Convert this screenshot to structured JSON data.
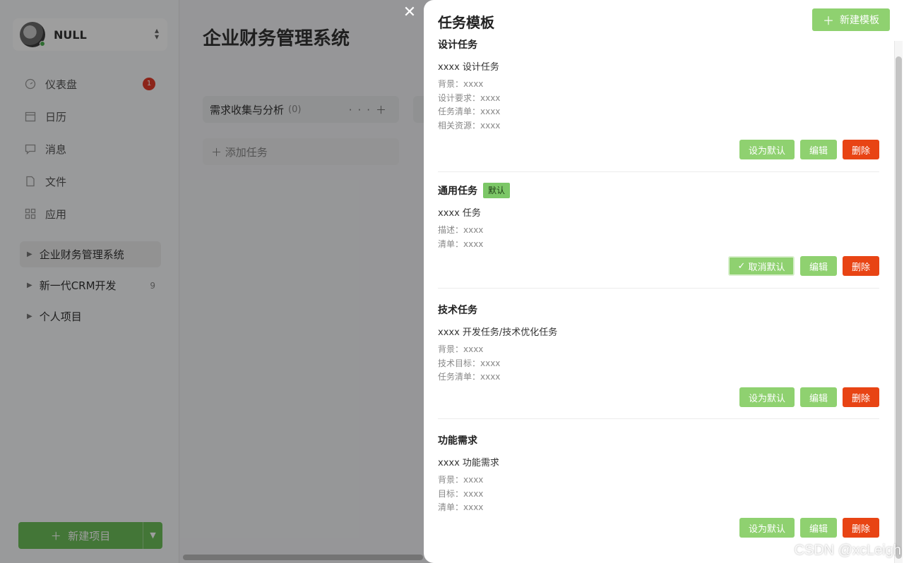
{
  "user": {
    "name": "NULL"
  },
  "nav": [
    {
      "label": "仪表盘",
      "icon": "dashboard-icon",
      "badge": "1"
    },
    {
      "label": "日历",
      "icon": "calendar-icon"
    },
    {
      "label": "消息",
      "icon": "message-icon"
    },
    {
      "label": "文件",
      "icon": "file-icon"
    },
    {
      "label": "应用",
      "icon": "apps-icon"
    }
  ],
  "projects": [
    {
      "label": "企业财务管理系统",
      "count": ""
    },
    {
      "label": "新一代CRM开发",
      "count": "9"
    },
    {
      "label": "个人项目",
      "count": ""
    }
  ],
  "new_project_label": "新建项目",
  "main": {
    "title": "企业财务管理系统",
    "column": {
      "title": "需求收集与分析",
      "count": "(0)",
      "add_label": "添加任务"
    }
  },
  "drawer": {
    "title": "任务模板",
    "new_template_label": "新建模板",
    "default_tag": "默认",
    "set_default_label": "设为默认",
    "cancel_default_label": "取消默认",
    "edit_label": "编辑",
    "delete_label": "删除",
    "templates": [
      {
        "name": "设计任务",
        "desc": "xxxx 设计任务",
        "lines": [
          "背景：xxxx",
          "设计要求：xxxx",
          "任务清单：xxxx",
          "相关资源：xxxx"
        ],
        "is_default": false
      },
      {
        "name": "通用任务",
        "desc": "xxxx 任务",
        "lines": [
          "描述：xxxx",
          "清单：xxxx"
        ],
        "is_default": true
      },
      {
        "name": "技术任务",
        "desc": "xxxx 开发任务/技术优化任务",
        "lines": [
          "背景：xxxx",
          "技术目标：xxxx",
          "任务清单：xxxx"
        ],
        "is_default": false
      },
      {
        "name": "功能需求",
        "desc": "xxxx 功能需求",
        "lines": [
          "背景：xxxx",
          "目标：xxxx",
          "清单：xxxx"
        ],
        "is_default": false
      }
    ]
  },
  "watermark": "CSDN @xcLeigh",
  "colors": {
    "primary": "#8fd170",
    "danger": "#e84414",
    "badge": "#e23c2a"
  }
}
